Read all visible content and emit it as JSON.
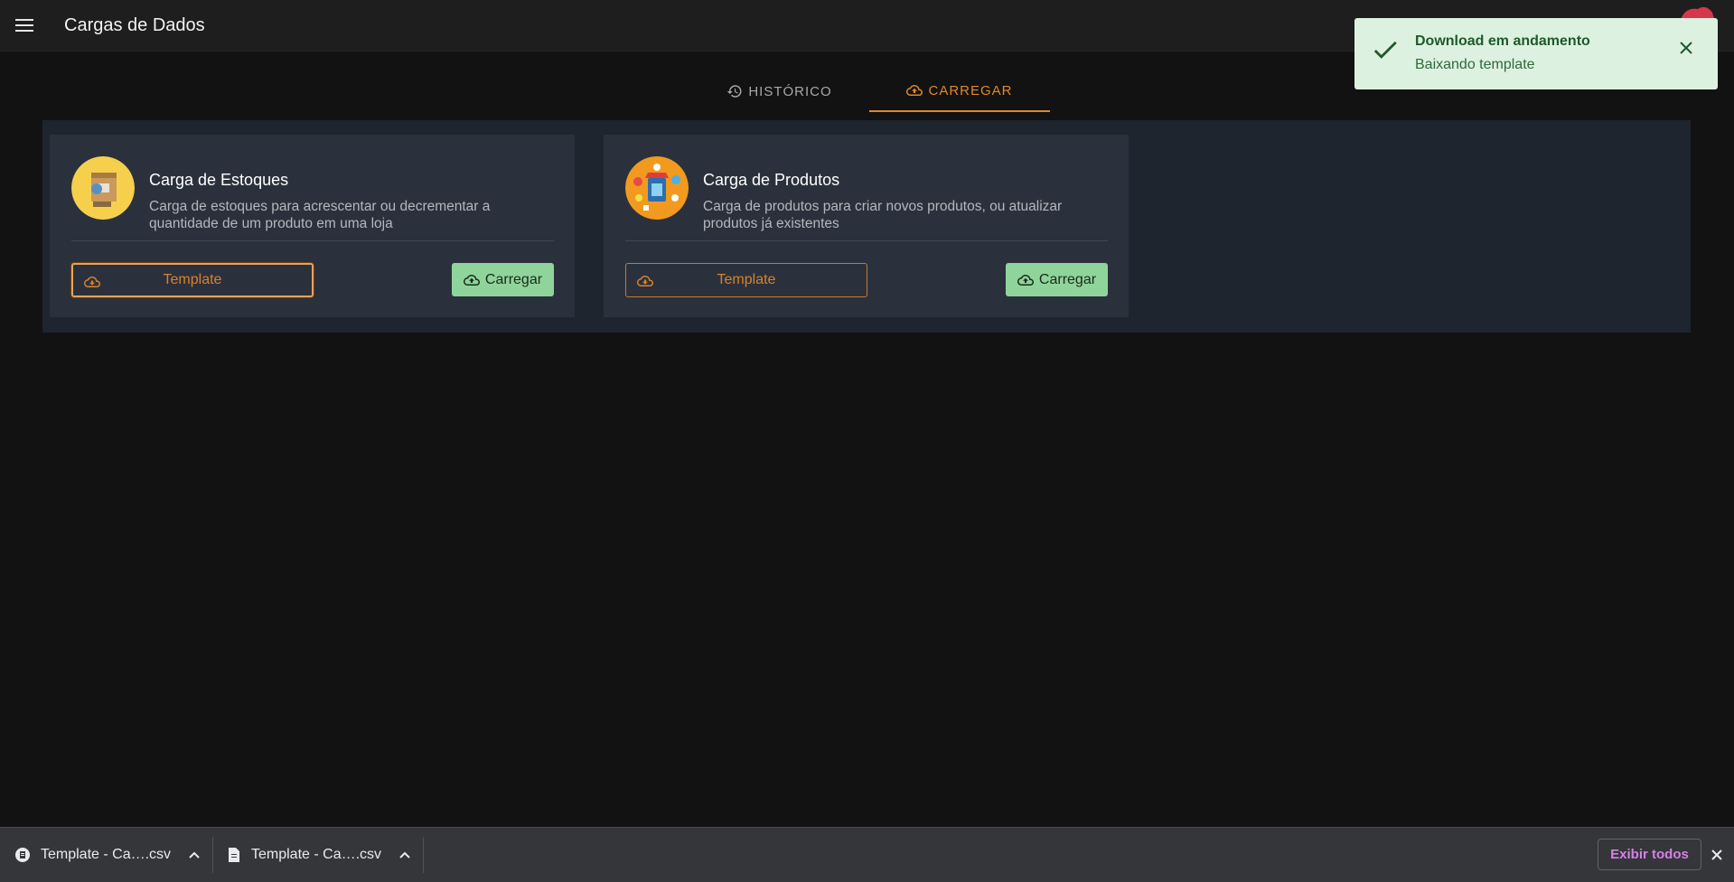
{
  "app": {
    "title": "Cargas de Dados"
  },
  "tabs": [
    {
      "label": "HISTÓRICO",
      "icon": "history-icon"
    },
    {
      "label": "CARREGAR",
      "icon": "cloud-upload-icon",
      "active": true
    }
  ],
  "cards": [
    {
      "title": "Carga de Estoques",
      "description": "Carga de estoques para acrescentar ou decrementar a quantidade de um produto em uma loja",
      "template_label": "Template",
      "load_label": "Carregar",
      "icon": "stock-boxes-illustration"
    },
    {
      "title": "Carga de Produtos",
      "description": "Carga de produtos para criar novos produtos, ou atualizar produtos já existentes",
      "template_label": "Template",
      "load_label": "Carregar",
      "icon": "store-products-illustration"
    }
  ],
  "toast": {
    "title": "Download em andamento",
    "message": "Baixando template"
  },
  "downloads": {
    "items": [
      {
        "name": "Template - Ca….csv"
      },
      {
        "name": "Template - Ca….csv"
      }
    ],
    "show_all_label": "Exibir todos"
  },
  "colors": {
    "accent": "#e0872a",
    "success_button": "#8fd49a",
    "toast_bg": "#ddf1e1",
    "background": "#121212",
    "panel": "#1f252e",
    "card": "#2b313c"
  }
}
